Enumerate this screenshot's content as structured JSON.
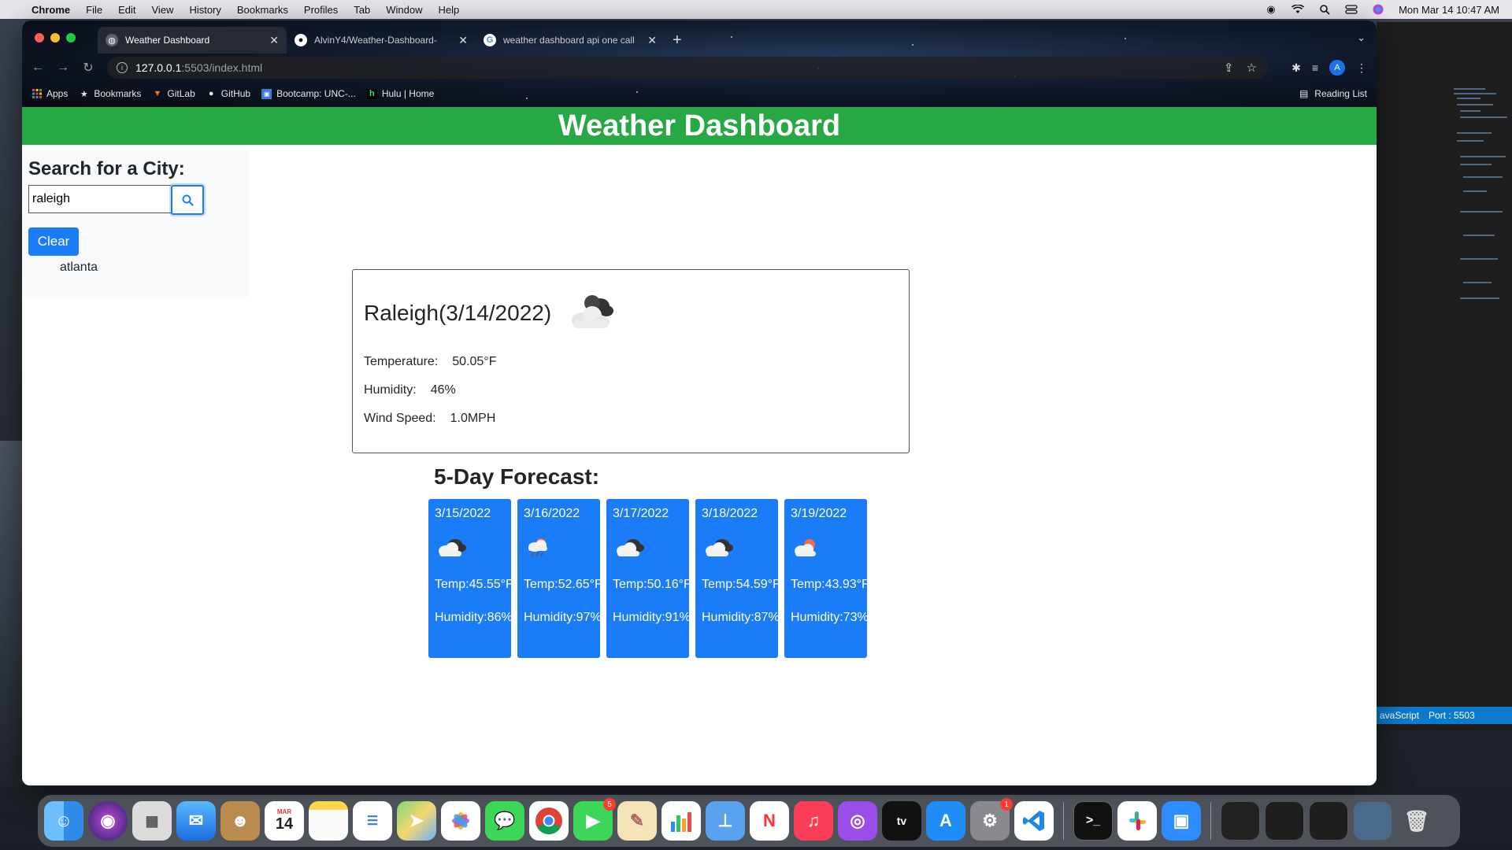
{
  "menubar": {
    "app": "Chrome",
    "items": [
      "File",
      "Edit",
      "View",
      "History",
      "Bookmarks",
      "Profiles",
      "Tab",
      "Window",
      "Help"
    ],
    "clock": "Mon Mar 14  10:47 AM"
  },
  "browser": {
    "tabs": [
      {
        "title": "Weather Dashboard"
      },
      {
        "title": "AlvinY4/Weather-Dashboard-"
      },
      {
        "title": "weather dashboard api one call"
      }
    ],
    "url_host": "127.0.0.1",
    "url_path": ":5503/index.html",
    "profile_initial": "A",
    "bookmarks": [
      {
        "label": "Apps",
        "icon": "apps-grid-icon"
      },
      {
        "label": "Bookmarks",
        "icon": "star-icon"
      },
      {
        "label": "GitLab",
        "icon": "gitlab-icon"
      },
      {
        "label": "GitHub",
        "icon": "github-icon"
      },
      {
        "label": "Bootcamp: UNC-...",
        "icon": "bootcamp-icon"
      },
      {
        "label": "Hulu | Home",
        "icon": "hulu-icon"
      }
    ],
    "reading_list": "Reading List"
  },
  "page": {
    "header_title": "Weather Dashboard",
    "search": {
      "heading": "Search for a City:",
      "value": "raleigh",
      "clear_label": "Clear",
      "history": [
        "atlanta"
      ]
    },
    "current": {
      "city_date": "Raleigh(3/14/2022)",
      "icon": "cloudy-icon",
      "temperature_label": "Temperature:",
      "temperature_value": "50.05°F",
      "humidity_label": "Humidity:",
      "humidity_value": "46%",
      "wind_label": "Wind Speed:",
      "wind_value": "1.0MPH"
    },
    "forecast_title": "5-Day Forecast:",
    "forecast": [
      {
        "date": "3/15/2022",
        "icon": "broken-clouds-icon",
        "temp": "Temp:45.55°F",
        "humidity": "Humidity:86%"
      },
      {
        "date": "3/16/2022",
        "icon": "rain-icon",
        "temp": "Temp:52.65°F",
        "humidity": "Humidity:97%"
      },
      {
        "date": "3/17/2022",
        "icon": "broken-clouds-icon",
        "temp": "Temp:50.16°F",
        "humidity": "Humidity:91%"
      },
      {
        "date": "3/18/2022",
        "icon": "broken-clouds-icon",
        "temp": "Temp:54.59°F",
        "humidity": "Humidity:87%"
      },
      {
        "date": "3/19/2022",
        "icon": "few-clouds-icon",
        "temp": "Temp:43.93°F",
        "humidity": "Humidity:73%"
      }
    ]
  },
  "editor_status": {
    "language": "avaScript",
    "port": "Port : 5503"
  },
  "dock": {
    "calendar_month": "MAR",
    "calendar_day": "14",
    "facetime_badge": "5",
    "settings_badge": "1"
  },
  "colors": {
    "header_green": "#28a745",
    "card_blue": "#1a7cf6"
  }
}
